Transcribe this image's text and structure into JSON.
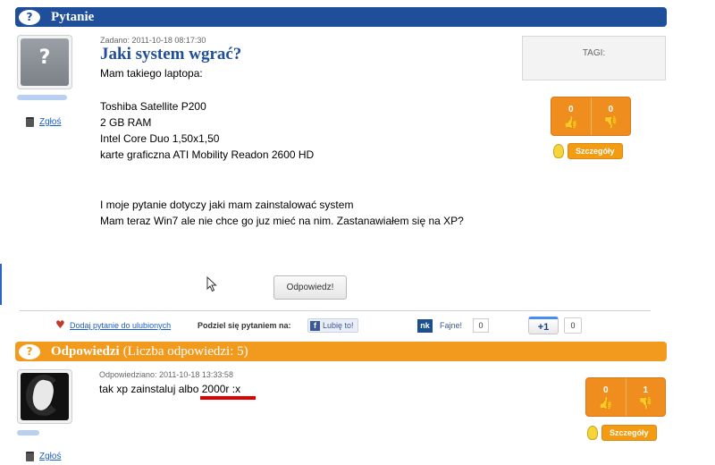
{
  "question_header": {
    "title": "Pytanie"
  },
  "question": {
    "meta": "Zadano: 2011-10-18 08:17:30",
    "title": "Jaki system wgrać?",
    "intro": "Mam takiego laptopa:",
    "specs": [
      "Toshiba Satellite P200",
      "2 GB RAM",
      "Intel Core Duo 1,50x1,50",
      "karte graficzna ATI Mobility Readon 2600 HD"
    ],
    "paragraph": [
      "I moje pytanie dotyczy jaki mam zainstalować system",
      "Mam teraz Win7 ale nie chce go juz mieć na nim. Zastanawiałem się na XP?"
    ],
    "report_label": "Zgłoś",
    "tags_label": "TAGI:",
    "votes_up": "0",
    "votes_down": "0",
    "details_label": "Szczegóły",
    "reply_label": "Odpowiedz!"
  },
  "social": {
    "favorite_label": "Dodaj pytanie do ulubionych",
    "share_label": "Podziel się pytaniem na:",
    "fb_label": "Lubię to!",
    "fb_icon": "f",
    "nk_icon": "nk",
    "nk_label": "Fajne!",
    "nk_count": "0",
    "gplus_label": "+1",
    "gplus_count": "0"
  },
  "answers_header": {
    "title": "Odpowiedzi",
    "count_text": "(Liczba odpowiedzi: 5)"
  },
  "answer": {
    "meta": "Odpowiedziano: 2011-10-18 13:33:58",
    "text": "tak xp zainstaluj albo 2000r :x",
    "report_label": "Zgłoś",
    "votes_up": "0",
    "votes_down": "1",
    "details_label": "Szczegóły"
  },
  "icons": {
    "header_icon": "question-mark-icon",
    "report_icon": "trash-icon",
    "vote_up_icon": "thumb-up-icon",
    "vote_down_icon": "thumb-down-icon",
    "details_icon": "lightbulb-icon",
    "favorite_icon": "heart-icon"
  },
  "colors": {
    "blue_header": "#1f4e9a",
    "orange_header": "#f29a1e",
    "vote_orange": "#ef8d1f",
    "link_blue": "#1a5fc7",
    "redaction": "#e00000"
  }
}
